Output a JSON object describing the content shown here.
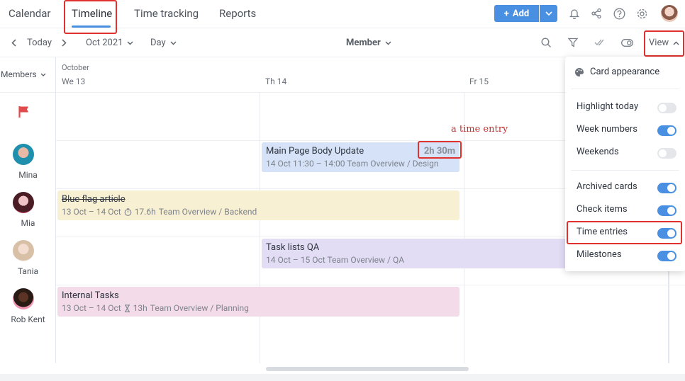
{
  "nav": {
    "tabs": [
      "Calendar",
      "Timeline",
      "Time tracking",
      "Reports"
    ],
    "active": "Timeline",
    "add_label": "Add"
  },
  "toolbar": {
    "today": "Today",
    "month": "Oct 2021",
    "scale": "Day",
    "group": "Member",
    "view": "View"
  },
  "grid": {
    "members_label": "Members",
    "month_label": "October",
    "days": [
      "We 13",
      "Th 14",
      "Fr 15"
    ]
  },
  "members": [
    "Mina",
    "Mia",
    "Tania",
    "Rob Kent"
  ],
  "cards": {
    "main_page": {
      "title": "Main Page Body Update",
      "sub": "14 Oct 11:30 – 14:00  Team Overview / Design",
      "time": "2h 30m"
    },
    "blue_flag": {
      "title": "Blue flag article",
      "dates": "13 Oct – 14 Oct",
      "hours": "17.6h",
      "path": "Team Overview / Backend"
    },
    "task_lists": {
      "title": "Task lists QA",
      "sub": "14 Oct – 15 Oct  Team Overview / QA"
    },
    "internal": {
      "title": "Internal Tasks",
      "dates": "13 Oct – 14 Oct",
      "hours": "13h",
      "path": "Team Overview / Planning"
    }
  },
  "annotation": "a time entry",
  "panel": {
    "card_appearance": "Card appearance",
    "items": [
      {
        "label": "Highlight today",
        "on": false
      },
      {
        "label": "Week numbers",
        "on": true
      },
      {
        "label": "Weekends",
        "on": false
      },
      {
        "label": "Archived cards",
        "on": true
      },
      {
        "label": "Check items",
        "on": true
      },
      {
        "label": "Time entries",
        "on": true
      },
      {
        "label": "Milestones",
        "on": true
      }
    ]
  },
  "colors": {
    "accent": "#4a90e2",
    "highlight": "#e0312f",
    "card_blue": "#d6e2f7",
    "card_yellow": "#f8f0d2",
    "card_purple": "#e2dcf4",
    "card_pink": "#f4dbe9"
  }
}
